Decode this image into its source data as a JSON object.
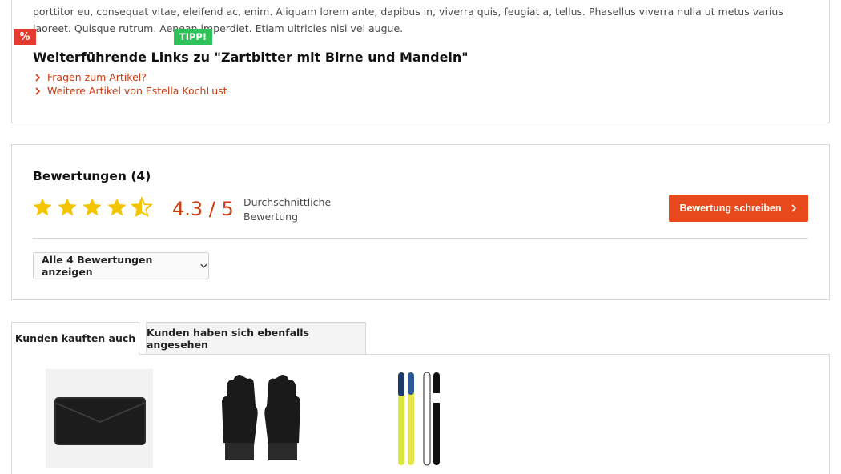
{
  "description": {
    "text": "porttitor eu, consequat vitae, eleifend ac, enim. Aliquam lorem ante, dapibus in, viverra quis, feugiat a, tellus. Phasellus viverra nulla ut metus varius laoreet. Quisque rutrum. Aenean imperdiet. Etiam ultricies nisi vel augue.",
    "links_title": "Weiterführende Links zu \"Zartbitter mit Birne und Mandeln\"",
    "links": [
      {
        "label": "Fragen zum Artikel?"
      },
      {
        "label": "Weitere Artikel von Estella KochLust"
      }
    ]
  },
  "reviews": {
    "title": "Bewertungen (4)",
    "rating": 4.3,
    "rating_text": "4.3 / 5",
    "rating_desc_line1": "Durchschnittliche",
    "rating_desc_line2": "Bewertung",
    "write_button": "Bewertung schreiben",
    "show_all": "Alle 4 Bewertungen anzeigen",
    "star_color": "#f5c400",
    "accent_color": "#e8491d"
  },
  "tabs": [
    {
      "label": "Kunden kauften auch",
      "active": true
    },
    {
      "label": "Kunden haben sich ebenfalls angesehen",
      "active": false
    }
  ],
  "products": [
    {
      "icon": "wallet-image",
      "badge": "%"
    },
    {
      "icon": "gloves-image",
      "badge": "TIPP!"
    },
    {
      "icon": "skis-image",
      "badge": ""
    }
  ]
}
